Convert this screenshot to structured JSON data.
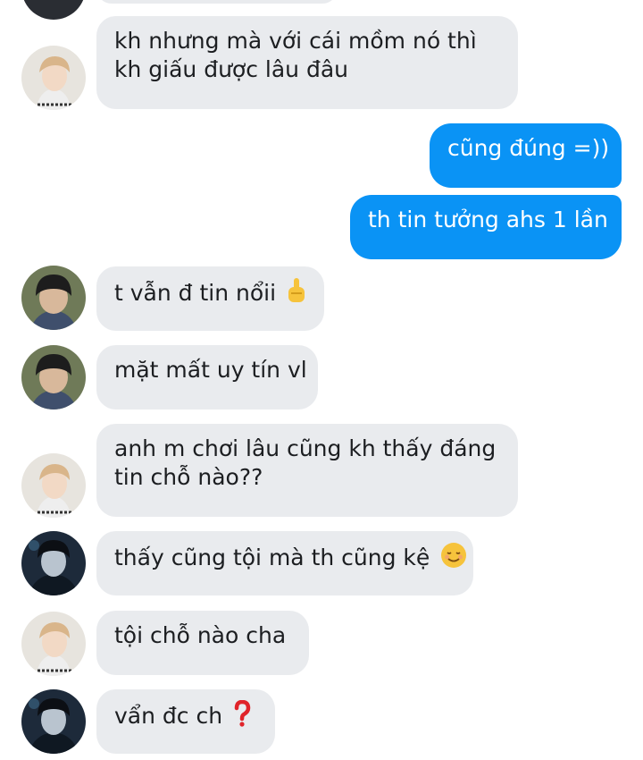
{
  "messages": [
    {
      "id": "m0",
      "direction": "incoming",
      "lines": [
        "kh nhưng mà với cái mồm nó thì",
        "kh giấu được lâu đâu"
      ],
      "avatar": "user-a-blonde"
    },
    {
      "id": "m1",
      "direction": "outgoing",
      "text": "cũng đúng =))"
    },
    {
      "id": "m2",
      "direction": "outgoing",
      "text": "th tin tưởng ahs 1 lần"
    },
    {
      "id": "m3",
      "direction": "incoming",
      "text": "t vẫn đ tin nổii",
      "emoji": "middle-finger-emoji",
      "avatar": "user-b-darkhair"
    },
    {
      "id": "m4",
      "direction": "incoming",
      "text": "mặt mất uy tín vl",
      "avatar": "user-b-darkhair"
    },
    {
      "id": "m5",
      "direction": "incoming",
      "lines": [
        "anh m chơi lâu cũng kh thấy đáng",
        "tin chỗ nào??"
      ],
      "avatar": "user-a-blonde"
    },
    {
      "id": "m6",
      "direction": "incoming",
      "text": "thấy cũng tội mà th cũng kệ",
      "emoji": "relieved-face-emoji",
      "avatar": "user-c-dark"
    },
    {
      "id": "m7",
      "direction": "incoming",
      "text": "tội chỗ nào cha",
      "avatar": "user-a-blonde"
    },
    {
      "id": "m8",
      "direction": "incoming",
      "text": "vẩn đc ch",
      "emoji": "red-question-mark-emoji",
      "avatar": "user-c-dark"
    }
  ],
  "colors": {
    "incoming_bubble": "#e9ebee",
    "outgoing_bubble": "#0a93f5",
    "incoming_text": "#1c1e21",
    "outgoing_text": "#ffffff"
  }
}
